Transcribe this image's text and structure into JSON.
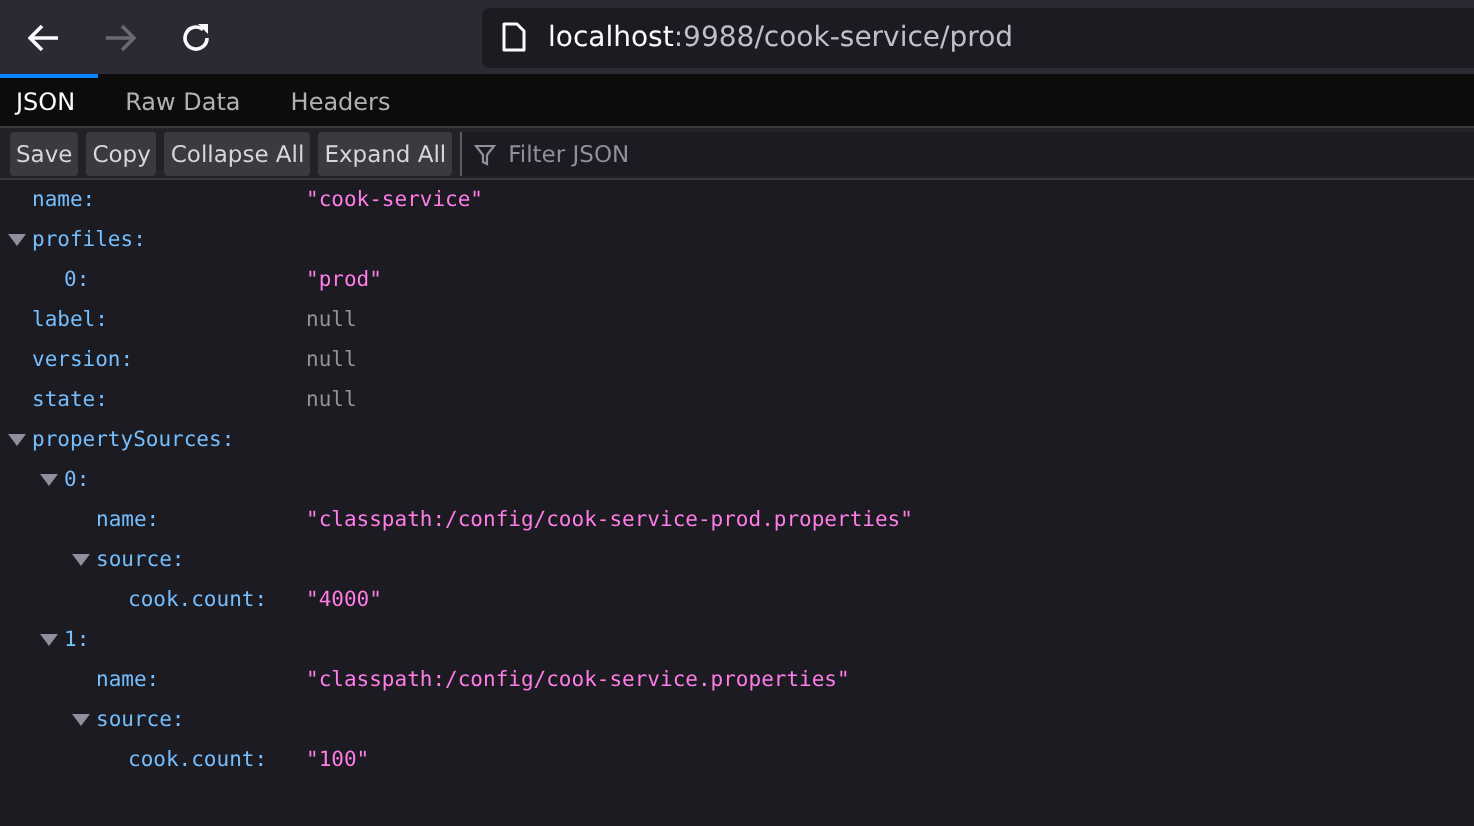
{
  "nav": {
    "forward_disabled": true
  },
  "url": {
    "host": "localhost",
    "path": ":9988/cook-service/prod"
  },
  "tabs": [
    {
      "label": "JSON",
      "selected": true
    },
    {
      "label": "Raw Data",
      "selected": false
    },
    {
      "label": "Headers",
      "selected": false
    }
  ],
  "toolbar": {
    "buttons": [
      "Save",
      "Copy",
      "Collapse All",
      "Expand All"
    ],
    "filter_placeholder": "Filter JSON"
  },
  "tree": [
    {
      "key": "name:",
      "value": "\"cook-service\"",
      "kind": "string"
    },
    {
      "key": "profiles:",
      "expanded": true,
      "children": [
        {
          "key": "0:",
          "value": "\"prod\"",
          "kind": "string"
        }
      ]
    },
    {
      "key": "label:",
      "value": "null",
      "kind": "null"
    },
    {
      "key": "version:",
      "value": "null",
      "kind": "null"
    },
    {
      "key": "state:",
      "value": "null",
      "kind": "null"
    },
    {
      "key": "propertySources:",
      "expanded": true,
      "children": [
        {
          "key": "0:",
          "expanded": true,
          "children": [
            {
              "key": "name:",
              "value": "\"classpath:/config/cook-service-prod.properties\"",
              "kind": "string"
            },
            {
              "key": "source:",
              "expanded": true,
              "children": [
                {
                  "key": "cook.count:",
                  "value": "\"4000\"",
                  "kind": "string"
                }
              ]
            }
          ]
        },
        {
          "key": "1:",
          "expanded": true,
          "children": [
            {
              "key": "name:",
              "value": "\"classpath:/config/cook-service.properties\"",
              "kind": "string"
            },
            {
              "key": "source:",
              "expanded": true,
              "children": [
                {
                  "key": "cook.count:",
                  "value": "\"100\"",
                  "kind": "string"
                }
              ]
            }
          ]
        }
      ]
    }
  ]
}
